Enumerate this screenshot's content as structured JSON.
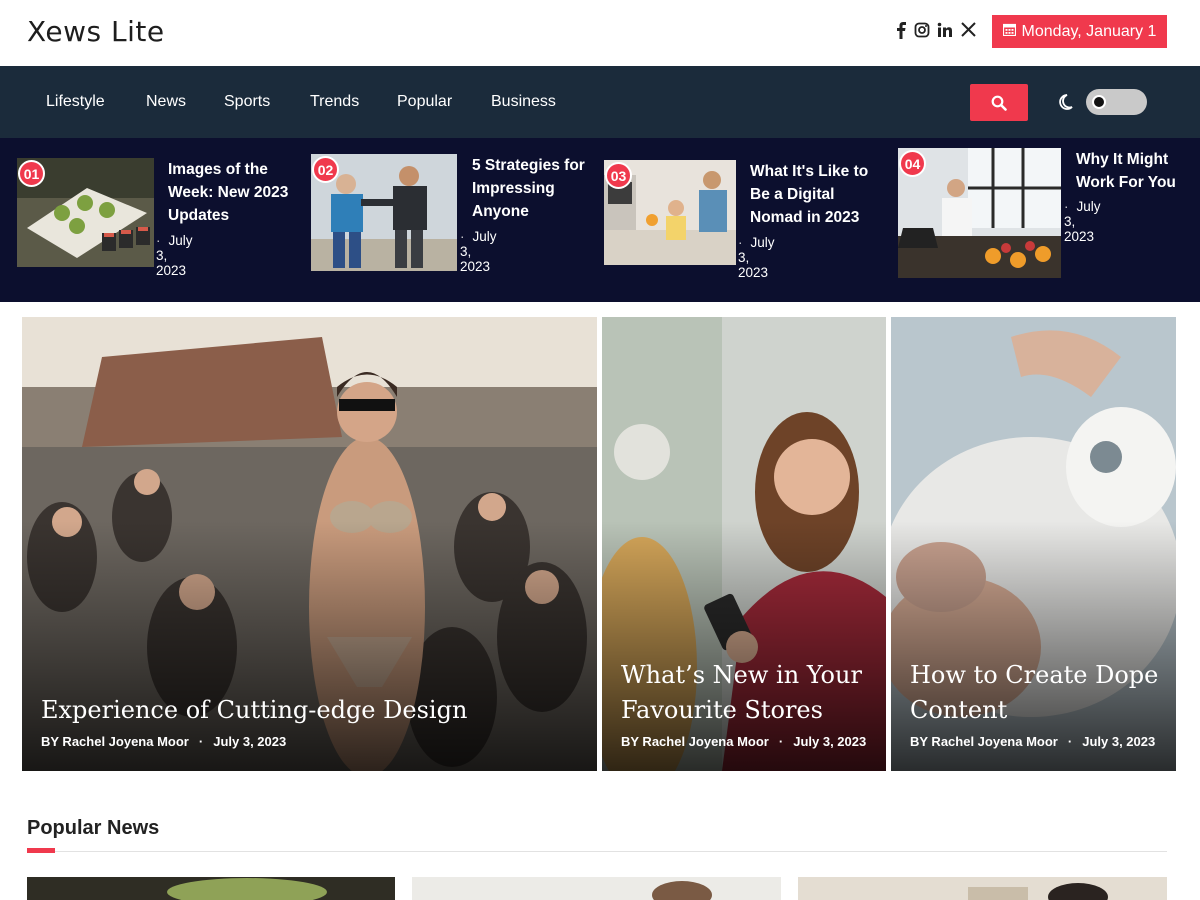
{
  "header": {
    "site_title": "Xews Lite",
    "social_icons": [
      "facebook-icon",
      "instagram-icon",
      "linkedin-icon",
      "x-icon"
    ],
    "date": "Monday, January 1"
  },
  "nav": {
    "items": [
      "Lifestyle",
      "News",
      "Sports",
      "Trends",
      "Popular",
      "Business"
    ]
  },
  "ticker": [
    {
      "num": "01",
      "title": "Images of the Week: New 2023 Updates",
      "date": "July 3, 2023"
    },
    {
      "num": "02",
      "title": "5 Strategies for Impressing Anyone",
      "date": "July 3, 2023"
    },
    {
      "num": "03",
      "title": "What It's Like to Be a Digital Nomad in 2023",
      "date": "July 3, 2023"
    },
    {
      "num": "04",
      "title": "Why It Might Work For You",
      "date": "July 3, 2023"
    }
  ],
  "featured": [
    {
      "title": "Experience of Cutting-edge Design",
      "author": "BY Rachel Joyena Moor",
      "date": "July 3, 2023"
    },
    {
      "title": "What’s New in Your Favourite Stores",
      "author": "BY Rachel Joyena Moor",
      "date": "July 3, 2023"
    },
    {
      "title": "How to Create Dope Content",
      "author": "BY Rachel Joyena Moor",
      "date": "July 3, 2023"
    }
  ],
  "popular": {
    "heading": "Popular News"
  },
  "colors": {
    "accent": "#f0394d",
    "nav_bg": "#1b2b3b",
    "ticker_bg": "#0c0f2e"
  }
}
